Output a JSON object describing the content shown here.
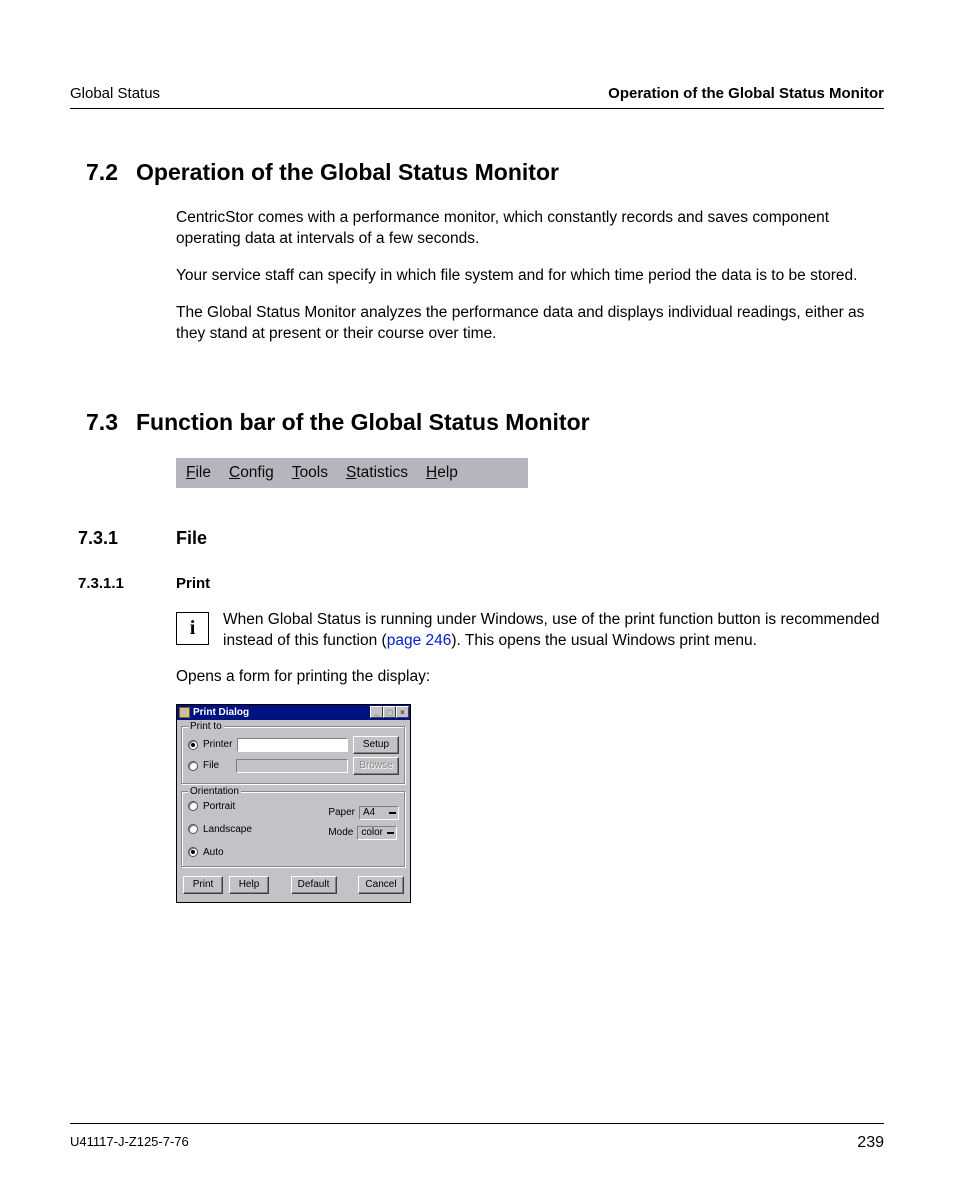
{
  "header": {
    "left": "Global Status",
    "right": "Operation of the Global Status Monitor"
  },
  "s72": {
    "num": "7.2",
    "title": "Operation of the Global Status Monitor",
    "p1": "CentricStor comes with a performance monitor, which constantly records and saves component operating data at intervals of a few seconds.",
    "p2": "Your service staff can specify in which file system and for which time period the data is to be stored.",
    "p3": "The Global Status Monitor analyzes the performance data and displays individual readings, either as they stand at present or their course over time."
  },
  "s73": {
    "num": "7.3",
    "title": "Function bar of the Global Status Monitor",
    "menu": {
      "file": "File",
      "config": "Config",
      "tools": "Tools",
      "stats": "Statistics",
      "help": "Help"
    }
  },
  "s731": {
    "num": "7.3.1",
    "title": "File"
  },
  "s7311": {
    "num": "7.3.1.1",
    "title": "Print",
    "info_a": "When Global Status is running under Windows, use of the print function button is recommended instead of this function (",
    "info_link": "page 246",
    "info_b": "). This opens the usual Windows print menu.",
    "lead": "Opens a form for printing the display:"
  },
  "dlg": {
    "title": "Print Dialog",
    "grp_printto": "Print to",
    "printer": "Printer",
    "file": "File",
    "setup": "Setup",
    "browse": "Browse",
    "grp_orient": "Orientation",
    "portrait": "Portrait",
    "landscape": "Landscape",
    "auto": "Auto",
    "paper": "Paper",
    "paper_val": "A4",
    "mode": "Mode",
    "mode_val": "color",
    "btn_print": "Print",
    "btn_help": "Help",
    "btn_default": "Default",
    "btn_cancel": "Cancel"
  },
  "footer": {
    "left": "U41117-J-Z125-7-76",
    "right": "239"
  }
}
